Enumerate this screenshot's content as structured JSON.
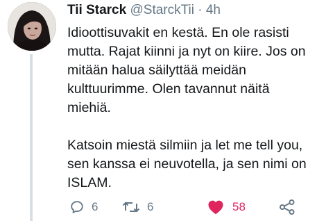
{
  "tweet": {
    "author_name": "Tii Starck",
    "author_handle": "@StarckTii",
    "separator": "·",
    "timestamp": "4h",
    "paragraphs": [
      "Idioottisuvakit en kestä. En ole rasisti mutta. Rajat kiinni ja nyt on kiire. Jos on mitään halua säilyttää meidän kulttuurimme. Olen tavannut näitä miehiä.",
      "Katsoin miestä silmiin ja let me tell you, sen kanssa ei neuvotella, ja sen nimi on ISLAM."
    ]
  },
  "actions": {
    "reply_count": "6",
    "retweet_count": "6",
    "like_count": "58",
    "like_active": true,
    "like_color": "#e0245e",
    "icon_color": "#657786",
    "reply_icon": "speech-bubble-icon",
    "retweet_icon": "retweet-arrows-icon",
    "like_icon": "heart-icon",
    "share_icon": "share-nodes-icon"
  }
}
